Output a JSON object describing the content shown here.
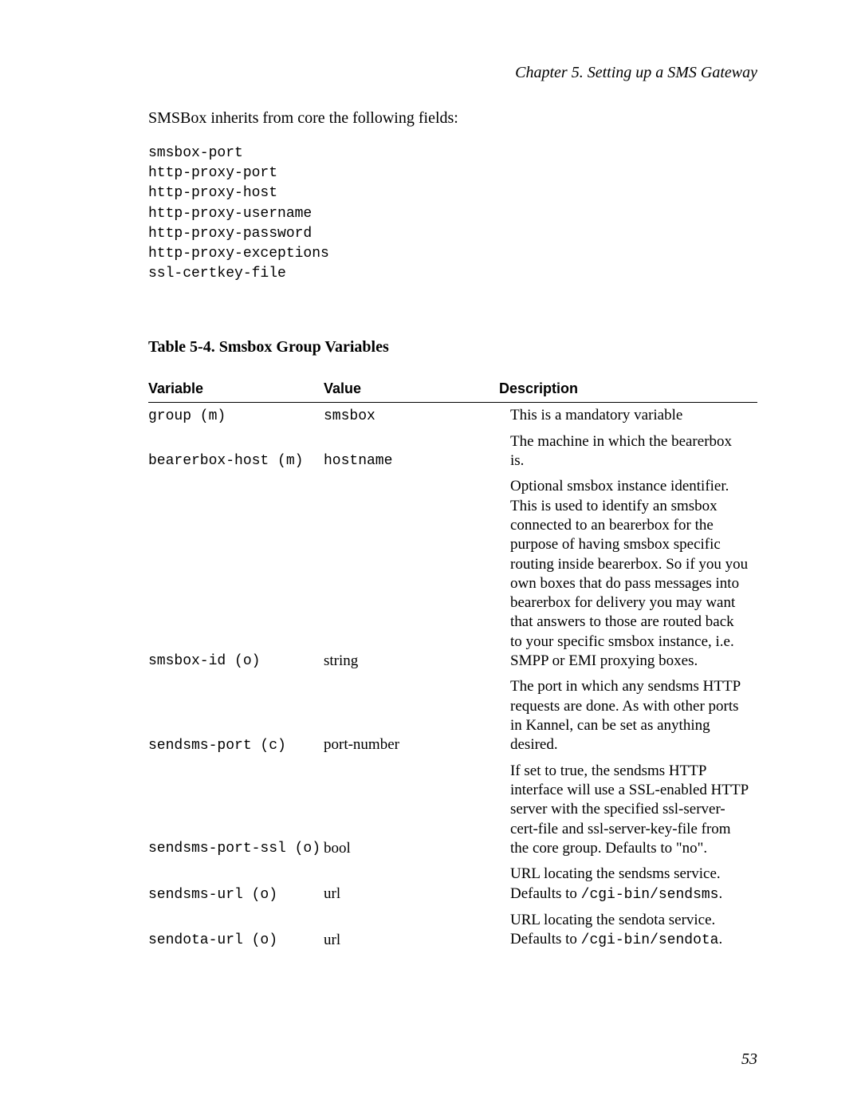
{
  "header": {
    "running_head": "Chapter 5. Setting up a SMS Gateway"
  },
  "intro": "SMSBox inherits from core the following fields:",
  "code_lines": [
    "smsbox-port",
    "http-proxy-port",
    "http-proxy-host",
    "http-proxy-username",
    "http-proxy-password",
    "http-proxy-exceptions",
    "ssl-certkey-file"
  ],
  "table": {
    "title": "Table 5-4. Smsbox Group Variables",
    "columns": {
      "variable": "Variable",
      "value": "Value",
      "description": "Description"
    },
    "rows": [
      {
        "variable": "group (m)",
        "value": "smsbox",
        "value_mono": true,
        "description": "This is a mandatory variable"
      },
      {
        "variable": "bearerbox-host (m)",
        "value": "hostname",
        "value_mono": true,
        "description": "The machine in which the bearerbox is."
      },
      {
        "variable": "smsbox-id (o)",
        "value": "string",
        "value_mono": false,
        "description": "Optional smsbox instance identifier. This is used to identify an smsbox connected to an bearerbox for the purpose of having smsbox specific routing inside bearerbox. So if you you own boxes that do pass messages into bearerbox for delivery you may want that answers to those are routed back to your specific smsbox instance, i.e. SMPP or EMI proxying boxes."
      },
      {
        "variable": "sendsms-port (c)",
        "value": "port-number",
        "value_mono": false,
        "description": "The port in which any sendsms HTTP requests are done. As with other ports in Kannel, can be set as anything desired."
      },
      {
        "variable": "sendsms-port-ssl (o)",
        "value": "bool",
        "value_mono": false,
        "description": "If set to true, the sendsms HTTP interface will use a SSL-enabled HTTP server with the specified ssl-server-cert-file and ssl-server-key-file from the core group. Defaults to \"no\"."
      },
      {
        "variable": "sendsms-url (o)",
        "value": "url",
        "value_mono": false,
        "description_prefix": "URL locating the sendsms service. Defaults to ",
        "description_code": "/cgi-bin/sendsms",
        "description_suffix": "."
      },
      {
        "variable": "sendota-url (o)",
        "value": "url",
        "value_mono": false,
        "description_prefix": "URL locating the sendota service. Defaults to ",
        "description_code": "/cgi-bin/sendota",
        "description_suffix": "."
      }
    ]
  },
  "page_number": "53"
}
